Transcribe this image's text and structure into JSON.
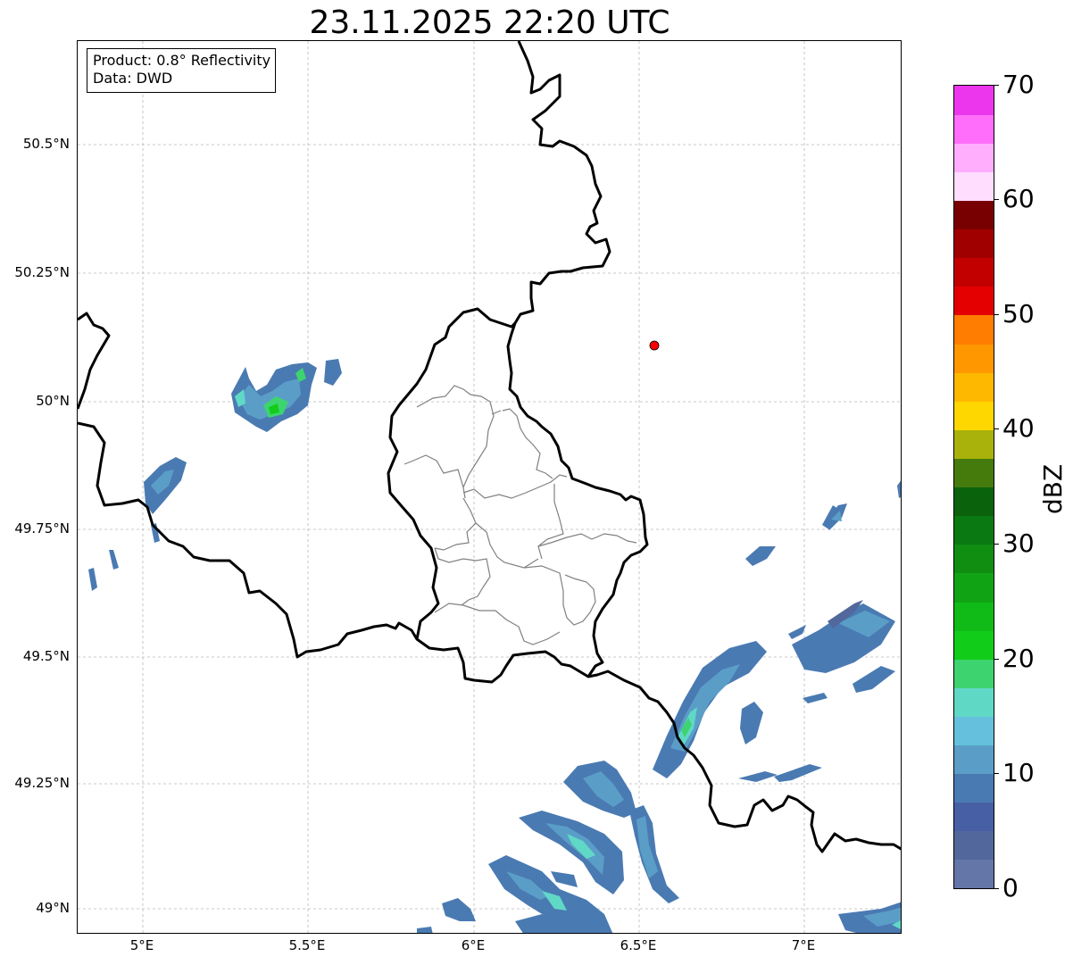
{
  "title": "23.11.2025 22:20 UTC",
  "info": {
    "product": "Product: 0.8° Reflectivity",
    "data": "Data: DWD"
  },
  "map": {
    "lon_range": [
      4.8,
      7.3
    ],
    "lat_range": [
      48.95,
      50.7
    ],
    "lat_ticks": [
      {
        "value": 50.5,
        "label": "50.5°N"
      },
      {
        "value": 50.25,
        "label": "50.25°N"
      },
      {
        "value": 50.0,
        "label": "50°N"
      },
      {
        "value": 49.75,
        "label": "49.75°N"
      },
      {
        "value": 49.5,
        "label": "49.5°N"
      },
      {
        "value": 49.25,
        "label": "49.25°N"
      },
      {
        "value": 49.0,
        "label": "49°N"
      }
    ],
    "lon_ticks": [
      {
        "value": 5.0,
        "label": "5°E"
      },
      {
        "value": 5.5,
        "label": "5.5°E"
      },
      {
        "value": 6.0,
        "label": "6°E"
      },
      {
        "value": 6.5,
        "label": "6.5°E"
      },
      {
        "value": 7.0,
        "label": "7°E"
      }
    ],
    "radar_site": {
      "lon": 6.55,
      "lat": 50.11,
      "color": "#ff0000"
    },
    "gridlines": true
  },
  "colorbar": {
    "label": "dBZ",
    "min": 0,
    "max": 70,
    "tick_labels": [
      "0",
      "10",
      "20",
      "30",
      "40",
      "50",
      "60",
      "70"
    ],
    "colors": [
      "#6475a7",
      "#52689d",
      "#4760a5",
      "#4a7ab2",
      "#5a9ec8",
      "#64c0dc",
      "#60d8c6",
      "#3dd470",
      "#12cc1a",
      "#10bb18",
      "#10a414",
      "#0f8e12",
      "#0b7912",
      "#0a630c",
      "#457a0d",
      "#a8b20a",
      "#fed700",
      "#ffb800",
      "#ff9800",
      "#ff7d00",
      "#e40000",
      "#c20000",
      "#a10000",
      "#780000",
      "#ffddff",
      "#ffaefd",
      "#ff6efa",
      "#ec36ee"
    ]
  }
}
